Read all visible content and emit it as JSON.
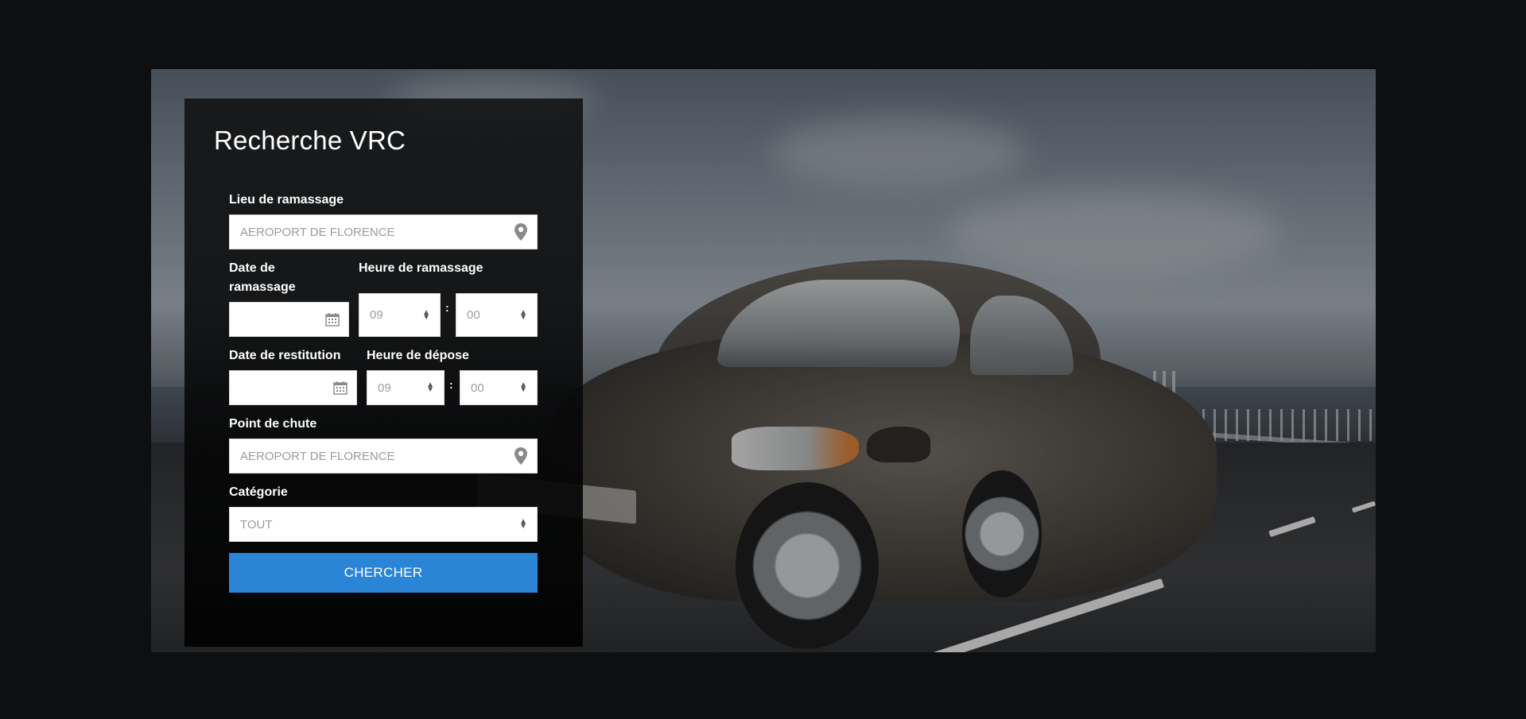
{
  "search": {
    "title": "Recherche VRC",
    "pickup_location": {
      "label": "Lieu de ramassage",
      "placeholder": "AEROPORT DE FLORENCE",
      "icon": "map-pin-icon"
    },
    "pickup_date": {
      "label": "Date de ramassage",
      "value": "",
      "icon": "calendar-icon"
    },
    "pickup_time": {
      "label": "Heure de ramassage",
      "hour": "09",
      "minute": "00",
      "separator": ":"
    },
    "return_date": {
      "label": "Date de restitution",
      "value": "",
      "icon": "calendar-icon"
    },
    "return_time": {
      "label": "Heure de dépose",
      "hour": "09",
      "minute": "00",
      "separator": ":"
    },
    "dropoff_location": {
      "label": "Point de chute",
      "placeholder": "AEROPORT DE FLORENCE",
      "icon": "map-pin-icon"
    },
    "category": {
      "label": "Catégorie",
      "value": "TOUT"
    },
    "submit_label": "CHERCHER"
  },
  "colors": {
    "accent": "#2a85d6",
    "page_background": "#0e0f10",
    "panel_background": "#0b0b0c"
  }
}
